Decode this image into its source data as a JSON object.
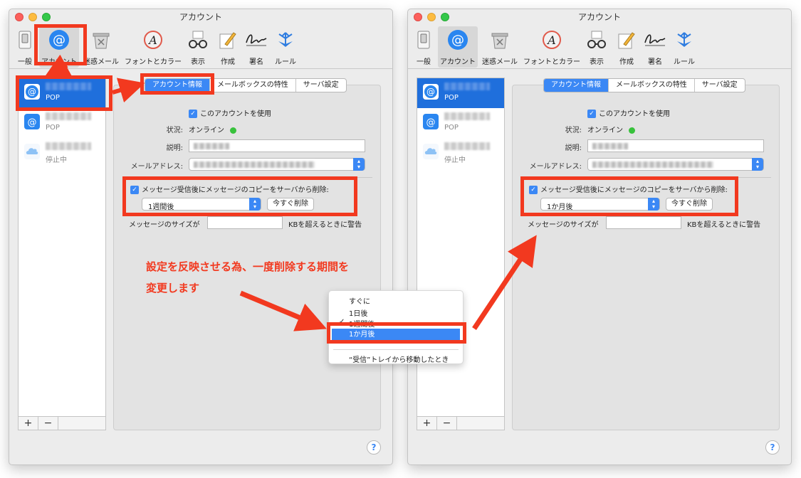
{
  "window": {
    "title": "アカウント",
    "toolbar": [
      {
        "label": "一般"
      },
      {
        "label": "アカウント"
      },
      {
        "label": "迷惑メール"
      },
      {
        "label": "フォントとカラー"
      },
      {
        "label": "表示"
      },
      {
        "label": "作成"
      },
      {
        "label": "署名"
      },
      {
        "label": "ルール"
      }
    ],
    "accounts": [
      {
        "sub": "POP"
      },
      {
        "sub": "POP"
      },
      {
        "sub": "停止中"
      }
    ],
    "list_buttons": {
      "add": "+",
      "remove": "−"
    },
    "tabs": [
      {
        "label": "アカウント情報"
      },
      {
        "label": "メールボックスの特性"
      },
      {
        "label": "サーバ設定"
      }
    ],
    "form": {
      "enable_label": "このアカウントを使用",
      "status_label": "状況:",
      "status_value": "オンライン",
      "description_label": "説明:",
      "email_label": "メールアドレス:",
      "remove_copy_label": "メッセージ受信後にメッセージのコピーをサーバから削除:",
      "remove_now_button": "今すぐ削除",
      "size_label": "メッセージのサイズが",
      "size_suffix": "KBを超えるときに警告"
    },
    "help": "?"
  },
  "left_window": {
    "remove_after_value": "1週間後"
  },
  "right_window": {
    "remove_after_value": "1か月後"
  },
  "annotation": {
    "line1": "設定を反映させる為、一度削除する期間を",
    "line2": "変更します"
  },
  "dropdown": {
    "items": [
      "すぐに",
      "1日後",
      "1週間後",
      "1か月後",
      "“受信”トレイから移動したとき"
    ],
    "checkmark": "✓"
  },
  "colors": {
    "accent": "#3b88f5",
    "selection": "#1f6fdc",
    "highlight": "#f2391f",
    "status_online": "#38c23c"
  }
}
